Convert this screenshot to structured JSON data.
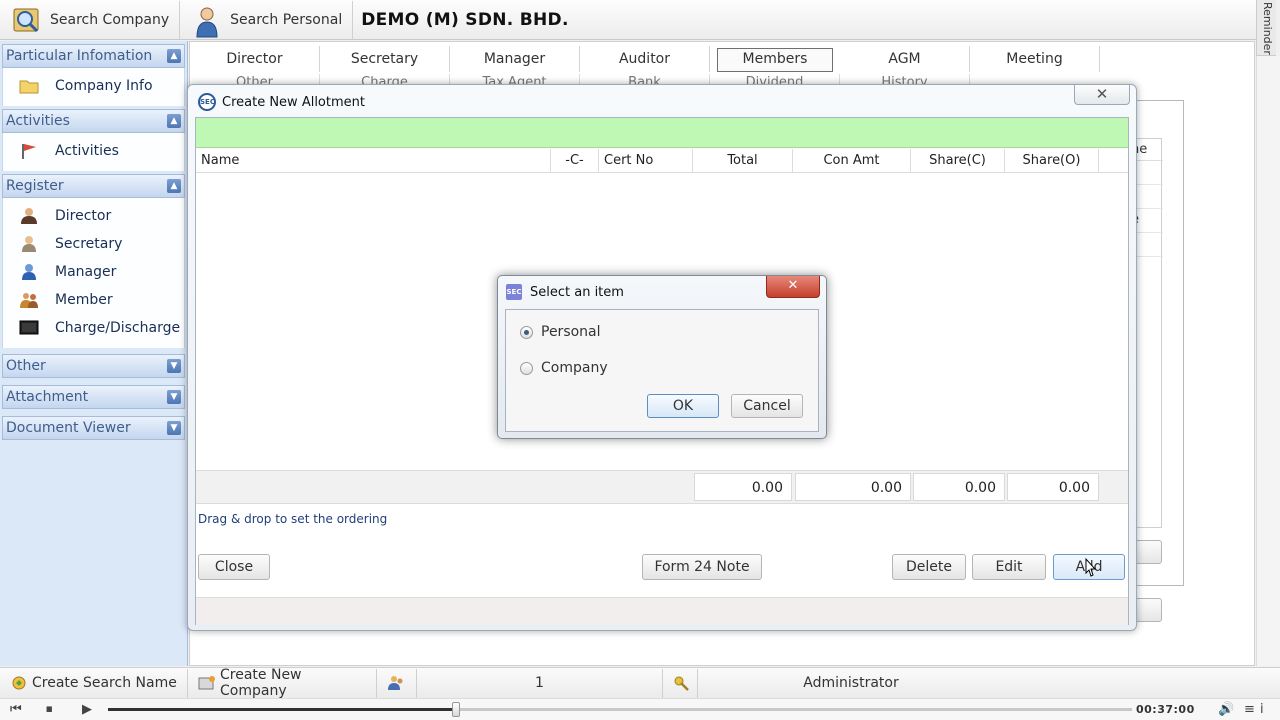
{
  "toolbar": {
    "search_company": "Search Company",
    "search_personal": "Search Personal",
    "company_name": "DEMO (M) SDN. BHD.",
    "reminder": "Reminder"
  },
  "sidebar": {
    "particular": {
      "title": "Particular Infomation",
      "items": [
        "Company Info"
      ]
    },
    "activities": {
      "title": "Activities",
      "items": [
        "Activities"
      ]
    },
    "register": {
      "title": "Register",
      "items": [
        "Director",
        "Secretary",
        "Manager",
        "Member",
        "Charge/Discharge"
      ]
    },
    "other": "Other",
    "attachment": "Attachment",
    "document_viewer": "Document Viewer"
  },
  "tabs": [
    "Director",
    "Secretary",
    "Manager",
    "Auditor",
    "Members",
    "AGM",
    "Meeting"
  ],
  "tabs_row2": [
    "Other",
    "Charge",
    "Tax Agent",
    "Bank",
    "Dividend",
    "History"
  ],
  "background": {
    "frag_header": "ne",
    "frag_row": "e"
  },
  "allotment": {
    "title": "Create New Allotment",
    "columns": [
      "Name",
      "-C-",
      "Cert No",
      "Total",
      "Con Amt",
      "Share(C)",
      "Share(O)"
    ],
    "totals": [
      "0.00",
      "0.00",
      "0.00",
      "0.00"
    ],
    "hint": "Drag & drop to set the ordering",
    "buttons": {
      "close": "Close",
      "form24": "Form 24 Note",
      "delete": "Delete",
      "edit": "Edit",
      "add": "Add"
    }
  },
  "select_dialog": {
    "title": "Select an item",
    "options": [
      "Personal",
      "Company"
    ],
    "selected": "Personal",
    "ok": "OK",
    "cancel": "Cancel"
  },
  "statusbar": {
    "create_search_name": "Create Search Name",
    "create_new_company": "Create New Company",
    "count": "1",
    "user": "Administrator"
  },
  "player": {
    "time": "00:37:00",
    "progress": 0.34
  },
  "colors": {
    "sidebar_bg": "#dbe8f8",
    "sidebar_head": "#3f5e8c",
    "green_bar": "#bff7b4",
    "close_red": "#c4402c"
  }
}
